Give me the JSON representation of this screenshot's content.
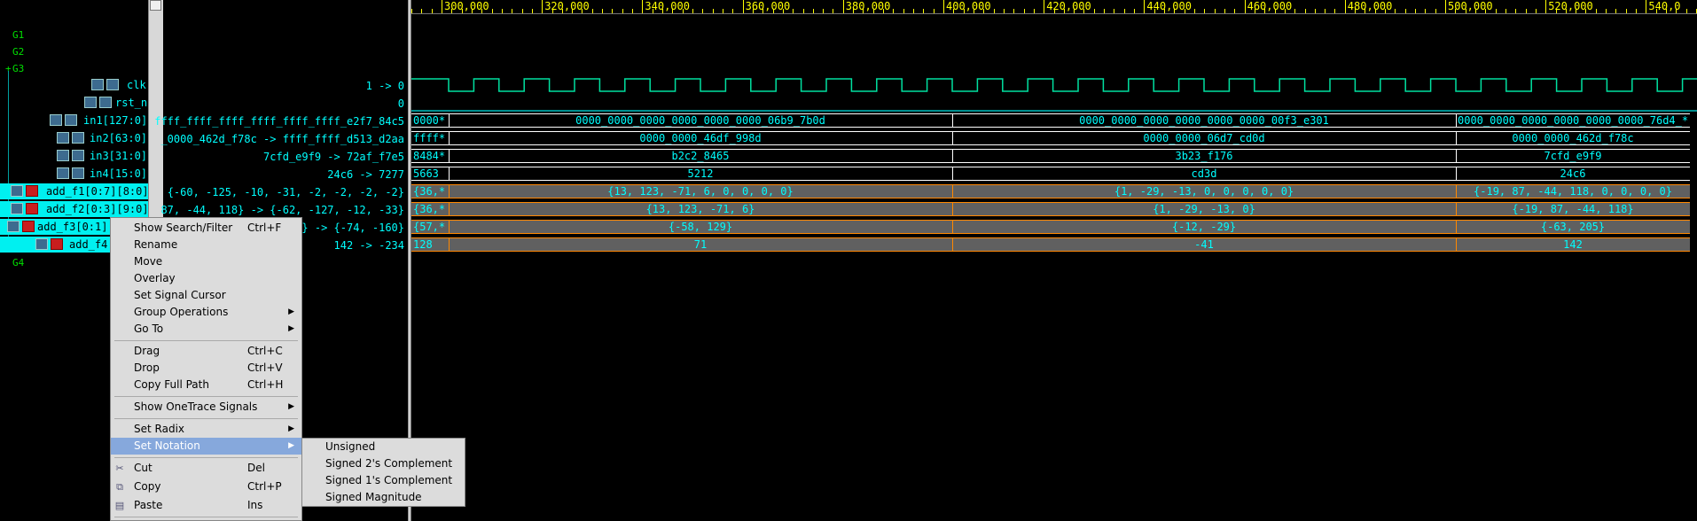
{
  "timeline": {
    "labels": [
      "300,000",
      "320,000",
      "340,000",
      "360,000",
      "380,000",
      "400,000",
      "420,000",
      "440,000",
      "460,000",
      "480,000",
      "500,000",
      "520,000",
      "540,0"
    ]
  },
  "groups": [
    "G1",
    "G2",
    "G3",
    "G4"
  ],
  "signals": [
    {
      "name": "clk",
      "value": "1 -> 0"
    },
    {
      "name": "rst_n",
      "value": "0"
    },
    {
      "name": "in1[127:0]",
      "value": "ffff_ffff_ffff_ffff_ffff_ffff_e2f7_84c5"
    },
    {
      "name": "in2[63:0]",
      "value": "_0000_462d_f78c -> ffff_ffff_d513_d2aa"
    },
    {
      "name": "in3[31:0]",
      "value": "7cfd_e9f9 -> 72af_f7e5"
    },
    {
      "name": "in4[15:0]",
      "value": "24c6 -> 7277"
    },
    {
      "name": "add_f1[0:7][8:0]",
      "value": "{-60, -125, -10, -31, -2, -2, -2, -2}"
    },
    {
      "name": "add_f2[0:3][9:0]",
      "value": "87, -44, 118} -> {-62, -127, -12, -33}"
    },
    {
      "name": "add_f3[0:1]",
      "value": "} -> {-74, -160}"
    },
    {
      "name": "add_f4",
      "value": "142 -> -234"
    }
  ],
  "waves": {
    "in1": {
      "first": "0000*",
      "segments": [
        "0000_0000_0000_0000_0000_0000_06b9_7b0d",
        "0000_0000_0000_0000_0000_0000_00f3_e301",
        "0000_0000_0000_0000_0000_0000_76d4_*"
      ]
    },
    "in2": {
      "first": "ffff*",
      "segments": [
        "0000_0000_46df_998d",
        "0000_0000_06d7_cd0d",
        "0000_0000_462d_f78c"
      ]
    },
    "in3": {
      "first": "8484*",
      "segments": [
        "b2c2_8465",
        "3b23_f176",
        "7cfd_e9f9"
      ]
    },
    "in4": {
      "first": "5663",
      "segments": [
        "5212",
        "cd3d",
        "24c6"
      ]
    },
    "add_f1": {
      "first": "{36,*",
      "segments": [
        "{13, 123, -71, 6, 0, 0, 0, 0}",
        "{1, -29, -13, 0, 0, 0, 0, 0}",
        "{-19, 87, -44, 118, 0, 0, 0, 0}"
      ]
    },
    "add_f2": {
      "first": "{36,*",
      "segments": [
        "{13, 123, -71, 6}",
        "{1, -29, -13, 0}",
        "{-19, 87, -44, 118}"
      ]
    },
    "add_f3": {
      "first": "{57,*",
      "segments": [
        "{-58, 129}",
        "{-12, -29}",
        "{-63, 205}"
      ]
    },
    "add_f4": {
      "first": "128",
      "segments": [
        "71",
        "-41",
        "142"
      ]
    }
  },
  "context_menu": {
    "items": [
      {
        "label": "Show Search/Filter",
        "accel": "Ctrl+F"
      },
      {
        "label": "Rename",
        "accel": ""
      },
      {
        "label": "Move",
        "accel": ""
      },
      {
        "label": "Overlay",
        "accel": ""
      },
      {
        "label": "Set Signal Cursor",
        "accel": ""
      },
      {
        "label": "Group Operations",
        "accel": ""
      },
      {
        "label": "Go To",
        "accel": ""
      },
      {
        "label": "Drag",
        "accel": "Ctrl+C"
      },
      {
        "label": "Drop",
        "accel": "Ctrl+V"
      },
      {
        "label": "Copy Full Path",
        "accel": "Ctrl+H"
      },
      {
        "label": "Show OneTrace Signals",
        "accel": ""
      },
      {
        "label": "Set Radix",
        "accel": ""
      },
      {
        "label": "Set Notation",
        "accel": ""
      },
      {
        "label": "Cut",
        "accel": "Del"
      },
      {
        "label": "Copy",
        "accel": "Ctrl+P"
      },
      {
        "label": "Paste",
        "accel": "Ins"
      }
    ]
  },
  "submenu": {
    "items": [
      "Unsigned",
      "Signed 2's Complement",
      "Signed 1's Complement",
      "Signed Magnitude"
    ]
  },
  "colors": {
    "signal": "#00ffff",
    "timeline": "#ffff00",
    "clock": "#00e0a0",
    "group": "#00e000",
    "menu_highlight": "#86a8dc"
  }
}
